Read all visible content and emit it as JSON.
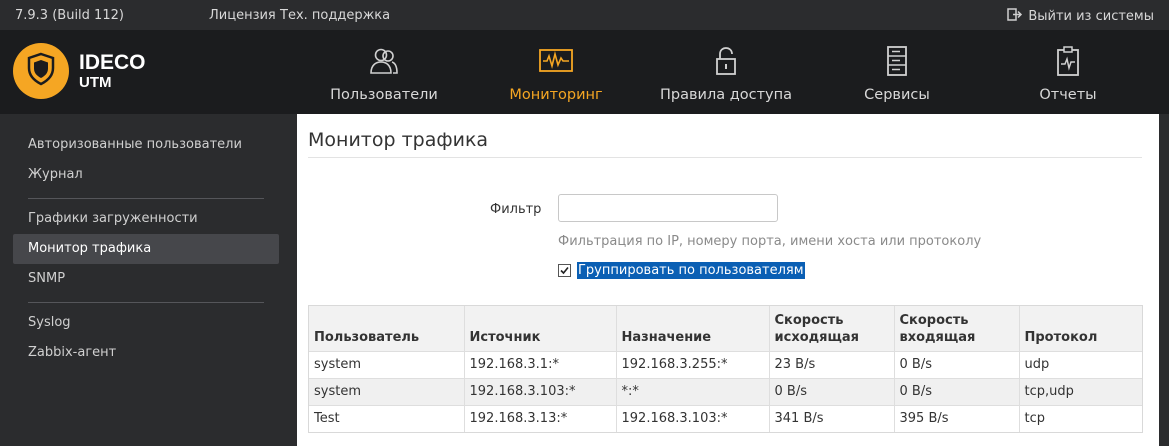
{
  "topbar": {
    "version": "7.9.3 (Build 112)",
    "license": "Лицензия",
    "support": "Тех. поддержка",
    "logout": "Выйти из системы"
  },
  "brand": {
    "name": "IDECO",
    "product": "UTM",
    "accent": "#f5a623"
  },
  "nav": {
    "items": [
      {
        "label": "Пользователи",
        "icon": "users-icon"
      },
      {
        "label": "Мониторинг",
        "icon": "monitoring-icon",
        "active": true
      },
      {
        "label": "Правила доступа",
        "icon": "unlock-icon"
      },
      {
        "label": "Сервисы",
        "icon": "server-icon"
      },
      {
        "label": "Отчеты",
        "icon": "clipboard-icon"
      }
    ]
  },
  "sidebar": {
    "items": [
      {
        "label": "Авторизованные пользователи"
      },
      {
        "label": "Журнал"
      },
      {
        "label": "Графики загруженности"
      },
      {
        "label": "Монитор трафика",
        "active": true
      },
      {
        "label": "SNMP"
      },
      {
        "label": "Syslog"
      },
      {
        "label": "Zabbix-агент"
      }
    ]
  },
  "main": {
    "title": "Монитор трафика",
    "filter": {
      "label": "Фильтр",
      "value": "",
      "placeholder": "",
      "help": "Фильтрация по IP, номеру порта, имени хоста или протоколу"
    },
    "group_by_users": {
      "label": "Группировать по пользователям",
      "checked": true
    },
    "table": {
      "headers": [
        "Пользователь",
        "Источник",
        "Назначение",
        "Скорость исходящая",
        "Скорость входящая",
        "Протокол"
      ],
      "rows": [
        [
          "system",
          "192.168.3.1:*",
          "192.168.3.255:*",
          "23 B/s",
          "0 B/s",
          "udp"
        ],
        [
          "system",
          "192.168.3.103:*",
          "*:*",
          "0 B/s",
          "0 B/s",
          "tcp,udp"
        ],
        [
          "Test",
          "192.168.3.13:*",
          "192.168.3.103:*",
          "341 B/s",
          "395 B/s",
          "tcp"
        ]
      ]
    }
  }
}
